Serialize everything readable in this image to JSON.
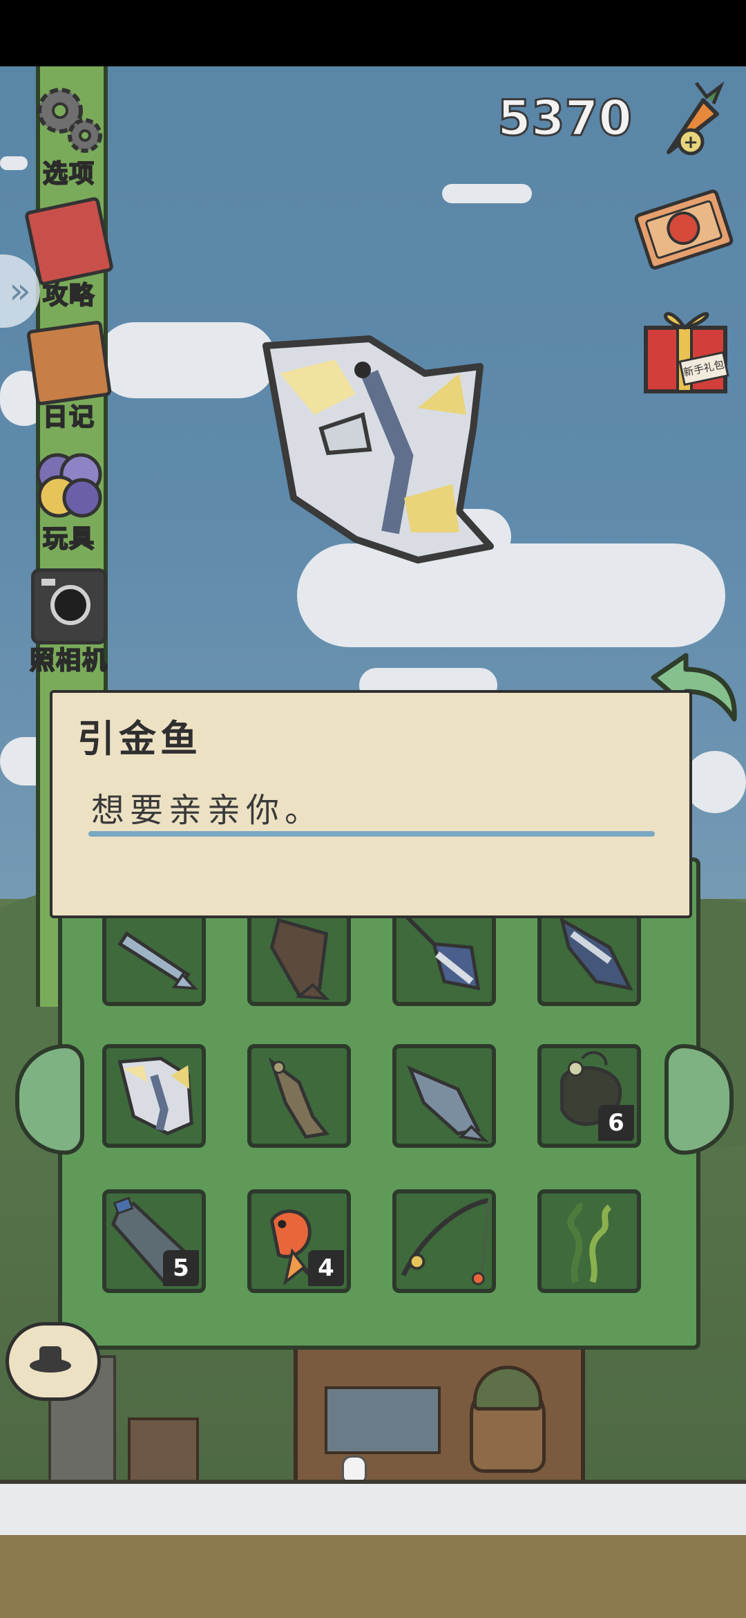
{
  "status_bar": {},
  "sidebar": {
    "items": [
      {
        "label": "选项",
        "icon": "gear-icon"
      },
      {
        "label": "攻略",
        "icon": "guide-book-icon"
      },
      {
        "label": "日记",
        "icon": "diary-icon"
      },
      {
        "label": "玩具",
        "icon": "toy-balls-icon"
      },
      {
        "label": "照相机",
        "icon": "camera-icon"
      }
    ],
    "expand_icon": "double-chevron-right-icon"
  },
  "header": {
    "carrot_count": "5370",
    "carrot_icon": "carrot-add-icon",
    "ticket_icon": "ticket-icon",
    "gift_icon": "gift-box-icon",
    "gift_label": "新手礼包"
  },
  "featured": {
    "fish_icon": "triggerfish-icon"
  },
  "dialog": {
    "title": "引金鱼",
    "text": "想要亲亲你。"
  },
  "collection": {
    "rows": [
      [
        {
          "icon": "sardine-icon",
          "count": ""
        },
        {
          "icon": "flounder-icon",
          "count": ""
        },
        {
          "icon": "swordfish-icon",
          "count": ""
        },
        {
          "icon": "tuna-icon",
          "count": ""
        }
      ],
      [
        {
          "icon": "triggerfish-icon",
          "count": ""
        },
        {
          "icon": "carp-icon",
          "count": ""
        },
        {
          "icon": "salmon-icon",
          "count": ""
        },
        {
          "icon": "anglerfish-icon",
          "count": "6"
        }
      ],
      [
        {
          "icon": "plastic-bottle-icon",
          "count": "5"
        },
        {
          "icon": "goldfish-icon",
          "count": "4"
        },
        {
          "icon": "fishing-rod-icon",
          "count": ""
        },
        {
          "icon": "seaweed-icon",
          "count": ""
        }
      ]
    ]
  },
  "colors": {
    "sky": "#5f8aac",
    "panel_green": "#5f9a59",
    "slot_green": "#3e6a3c",
    "dialog_bg": "#ede1c4",
    "rail_green": "#7aab5a"
  }
}
